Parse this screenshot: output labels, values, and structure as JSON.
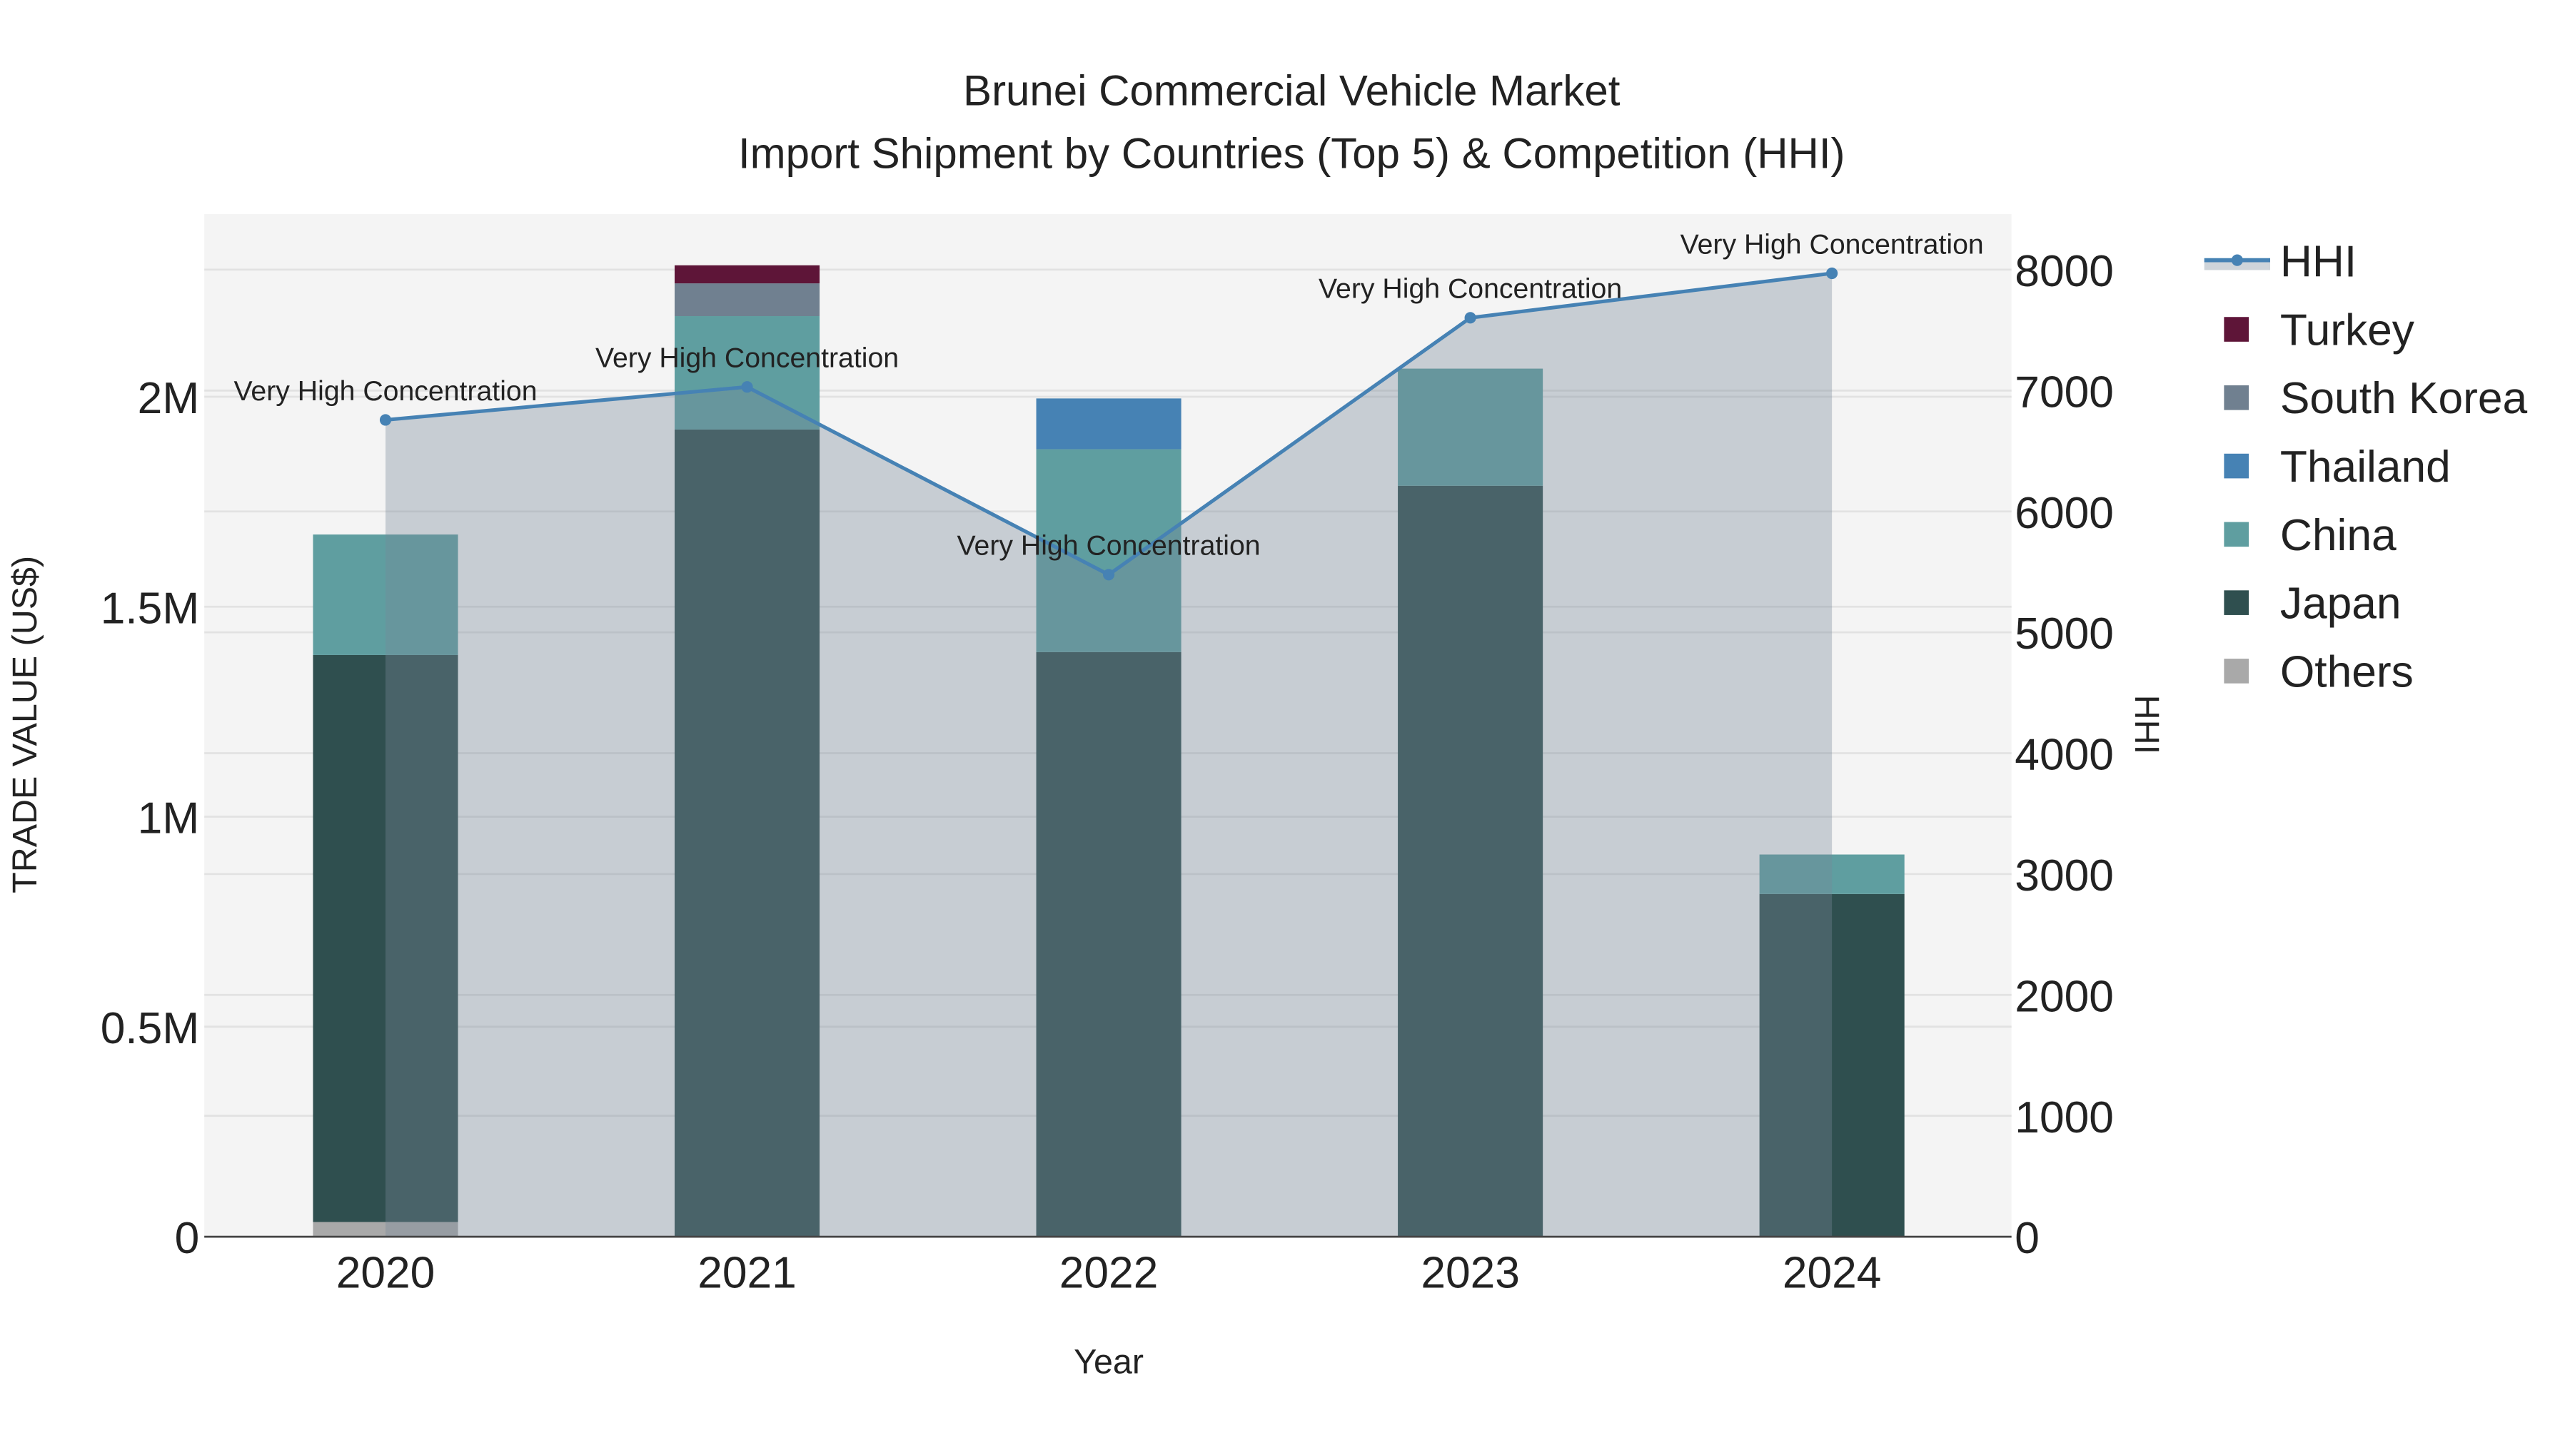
{
  "chart_data": {
    "type": "bar",
    "title_line1": "Brunei Commercial Vehicle Market",
    "title_line2": "Import Shipment by Countries (Top 5) & Competition (HHI)",
    "xlabel": "Year",
    "ylabel": "TRADE VALUE (US$)",
    "y2label": "HHI",
    "categories": [
      "2020",
      "2021",
      "2022",
      "2023",
      "2024"
    ],
    "ylim": [
      0,
      2435000
    ],
    "y2lim": [
      0,
      8460
    ],
    "yticks": [
      {
        "v": 0,
        "label": "0"
      },
      {
        "v": 500000,
        "label": "0.5M"
      },
      {
        "v": 1000000,
        "label": "1M"
      },
      {
        "v": 1500000,
        "label": "1.5M"
      },
      {
        "v": 2000000,
        "label": "2M"
      }
    ],
    "y2ticks": [
      0,
      1000,
      2000,
      3000,
      4000,
      5000,
      6000,
      7000,
      8000
    ],
    "grid": true,
    "legend_position": "right",
    "series": [
      {
        "name": "Others",
        "color": "#a9a9a9",
        "values": [
          35000,
          0,
          0,
          0,
          0
        ]
      },
      {
        "name": "Japan",
        "color": "#2f4f4f",
        "values": [
          1350000,
          1922000,
          1392000,
          1788000,
          816000
        ]
      },
      {
        "name": "China",
        "color": "#5f9ea0",
        "values": [
          287000,
          270000,
          483000,
          279000,
          94000
        ]
      },
      {
        "name": "Thailand",
        "color": "#4682b4",
        "values": [
          0,
          0,
          121000,
          0,
          0
        ]
      },
      {
        "name": "South Korea",
        "color": "#708090",
        "values": [
          0,
          78000,
          0,
          0,
          0
        ]
      },
      {
        "name": "Turkey",
        "color": "#5e1538",
        "values": [
          0,
          43000,
          0,
          0,
          0
        ]
      }
    ],
    "hhi": {
      "name": "HHI",
      "color": "#4682b4",
      "values": [
        6757,
        7030,
        5477,
        7602,
        7970
      ],
      "annotations": [
        "Very High Concentration",
        "Very High Concentration",
        "Very High Concentration",
        "Very High Concentration",
        "Very High Concentration"
      ]
    },
    "legend_order": [
      "HHI",
      "Turkey",
      "South Korea",
      "Thailand",
      "China",
      "Japan",
      "Others"
    ]
  }
}
